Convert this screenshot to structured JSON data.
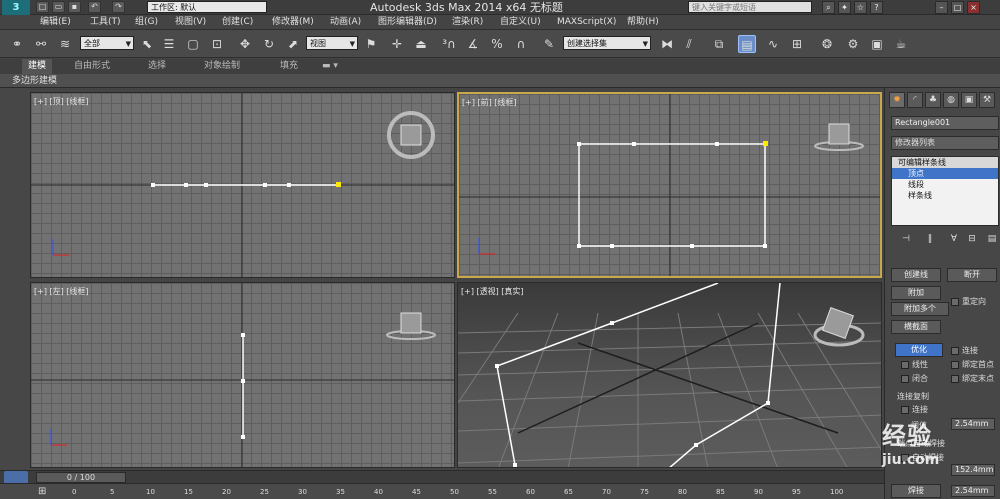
{
  "titlebar": {
    "logo": "3",
    "workspace_label": "工作区: 默认",
    "title": "Autodesk 3ds Max  2014 x64       无标题",
    "help_search_placeholder": "键入关键字或短语"
  },
  "menu": [
    "编辑(E)",
    "工具(T)",
    "组(G)",
    "视图(V)",
    "创建(C)",
    "修改器(M)",
    "动画(A)",
    "图形编辑器(D)",
    "渲染(R)",
    "自定义(U)",
    "MAXScript(X)",
    "帮助(H)"
  ],
  "toolbar": {
    "selection_filter": "全部",
    "ref_coord": "视图",
    "named_selection": "创建选择集"
  },
  "ribbon": {
    "tabs": [
      "建模",
      "自由形式",
      "选择",
      "对象绘制",
      "填充"
    ],
    "panel_label": "多边形建模"
  },
  "viewports": {
    "top": {
      "label": "[+] [顶] [线框]"
    },
    "front": {
      "label": "[+] [前] [线框]"
    },
    "left": {
      "label": "[+] [左] [线框]"
    },
    "persp": {
      "label": "[+] [透视] [真实]"
    }
  },
  "command_panel": {
    "object_name": "Rectangle001",
    "modifier_list": "修改器列表",
    "stack": {
      "root": "可编辑样条线",
      "items": [
        "顶点",
        "线段",
        "样条线"
      ]
    },
    "buttons": {
      "create_line": "创建线",
      "break": "断开",
      "attach": "附加",
      "reorient": "重定向",
      "attach_multiple": "附加多个",
      "cross_section": "横截面",
      "optimize": "优化",
      "connect": "连接",
      "linear": "线性",
      "bind_first": "绑定首点",
      "closed": "闭合",
      "bind_last": "绑定末点"
    },
    "connect_copy": {
      "title": "连接复制",
      "connect": "连接",
      "threshold_label": "阈值",
      "threshold_value": "2.54mm"
    },
    "end_point_label": "端点自动焊接",
    "auto_weld": "自动焊接",
    "weld_threshold_value": "152.4mm",
    "weld_label": "焊接",
    "weld_value": "2.54mm"
  },
  "timeline": {
    "frame": "0 / 100",
    "ticks": [
      "0",
      "5",
      "10",
      "15",
      "20",
      "25",
      "30",
      "35",
      "40",
      "45",
      "50",
      "55",
      "60",
      "65",
      "70",
      "75",
      "80",
      "85",
      "90",
      "95",
      "100"
    ]
  },
  "watermark": {
    "text": "经验",
    "url": "jiu.com"
  }
}
